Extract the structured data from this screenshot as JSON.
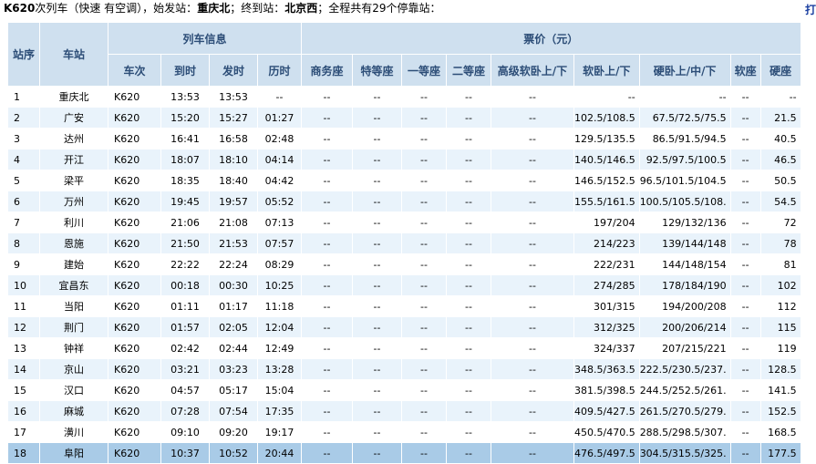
{
  "header": {
    "train_prefix": "K620",
    "train_desc": "次列车（快速 有空调），始发站：",
    "start_station": "重庆北",
    "sep1": "；终到站：",
    "end_station": "北京西",
    "stop_info": "；全程共有29个停靠站：",
    "right_link": "打"
  },
  "table": {
    "group_headers": {
      "seq": "站序",
      "station": "车站",
      "train_info": "列车信息",
      "fare": "票价（元）"
    },
    "columns": [
      "车次",
      "到时",
      "发时",
      "历时",
      "商务座",
      "特等座",
      "一等座",
      "二等座",
      "高级软卧上/下",
      "软卧上/下",
      "硬卧上/中/下",
      "软座",
      "硬座"
    ],
    "rows": [
      {
        "seq": "1",
        "station": "重庆北",
        "train": "K620",
        "arr": "13:53",
        "dep": "13:53",
        "dur": "--",
        "swz": "--",
        "tdz": "--",
        "ydz": "--",
        "edz": "--",
        "gjrw": "--",
        "rw": "--",
        "yw": "--",
        "rz": "--",
        "yz": "--"
      },
      {
        "seq": "2",
        "station": "广安",
        "train": "K620",
        "arr": "15:20",
        "dep": "15:27",
        "dur": "01:27",
        "swz": "--",
        "tdz": "--",
        "ydz": "--",
        "edz": "--",
        "gjrw": "--",
        "rw": "102.5/108.5",
        "yw": "67.5/72.5/75.5",
        "rz": "--",
        "yz": "21.5"
      },
      {
        "seq": "3",
        "station": "达州",
        "train": "K620",
        "arr": "16:41",
        "dep": "16:58",
        "dur": "02:48",
        "swz": "--",
        "tdz": "--",
        "ydz": "--",
        "edz": "--",
        "gjrw": "--",
        "rw": "129.5/135.5",
        "yw": "86.5/91.5/94.5",
        "rz": "--",
        "yz": "40.5"
      },
      {
        "seq": "4",
        "station": "开江",
        "train": "K620",
        "arr": "18:07",
        "dep": "18:10",
        "dur": "04:14",
        "swz": "--",
        "tdz": "--",
        "ydz": "--",
        "edz": "--",
        "gjrw": "--",
        "rw": "140.5/146.5",
        "yw": "92.5/97.5/100.5",
        "rz": "--",
        "yz": "46.5"
      },
      {
        "seq": "5",
        "station": "梁平",
        "train": "K620",
        "arr": "18:35",
        "dep": "18:40",
        "dur": "04:42",
        "swz": "--",
        "tdz": "--",
        "ydz": "--",
        "edz": "--",
        "gjrw": "--",
        "rw": "146.5/152.5",
        "yw": "96.5/101.5/104.5",
        "rz": "--",
        "yz": "50.5"
      },
      {
        "seq": "6",
        "station": "万州",
        "train": "K620",
        "arr": "19:45",
        "dep": "19:57",
        "dur": "05:52",
        "swz": "--",
        "tdz": "--",
        "ydz": "--",
        "edz": "--",
        "gjrw": "--",
        "rw": "155.5/161.5",
        "yw": "100.5/105.5/108.",
        "rz": "--",
        "yz": "54.5"
      },
      {
        "seq": "7",
        "station": "利川",
        "train": "K620",
        "arr": "21:06",
        "dep": "21:08",
        "dur": "07:13",
        "swz": "--",
        "tdz": "--",
        "ydz": "--",
        "edz": "--",
        "gjrw": "--",
        "rw": "197/204",
        "yw": "129/132/136",
        "rz": "--",
        "yz": "72"
      },
      {
        "seq": "8",
        "station": "恩施",
        "train": "K620",
        "arr": "21:50",
        "dep": "21:53",
        "dur": "07:57",
        "swz": "--",
        "tdz": "--",
        "ydz": "--",
        "edz": "--",
        "gjrw": "--",
        "rw": "214/223",
        "yw": "139/144/148",
        "rz": "--",
        "yz": "78"
      },
      {
        "seq": "9",
        "station": "建始",
        "train": "K620",
        "arr": "22:22",
        "dep": "22:24",
        "dur": "08:29",
        "swz": "--",
        "tdz": "--",
        "ydz": "--",
        "edz": "--",
        "gjrw": "--",
        "rw": "222/231",
        "yw": "144/148/154",
        "rz": "--",
        "yz": "81"
      },
      {
        "seq": "10",
        "station": "宜昌东",
        "train": "K620",
        "arr": "00:18",
        "dep": "00:30",
        "dur": "10:25",
        "swz": "--",
        "tdz": "--",
        "ydz": "--",
        "edz": "--",
        "gjrw": "--",
        "rw": "274/285",
        "yw": "178/184/190",
        "rz": "--",
        "yz": "102"
      },
      {
        "seq": "11",
        "station": "当阳",
        "train": "K620",
        "arr": "01:11",
        "dep": "01:17",
        "dur": "11:18",
        "swz": "--",
        "tdz": "--",
        "ydz": "--",
        "edz": "--",
        "gjrw": "--",
        "rw": "301/315",
        "yw": "194/200/208",
        "rz": "--",
        "yz": "112"
      },
      {
        "seq": "12",
        "station": "荆门",
        "train": "K620",
        "arr": "01:57",
        "dep": "02:05",
        "dur": "12:04",
        "swz": "--",
        "tdz": "--",
        "ydz": "--",
        "edz": "--",
        "gjrw": "--",
        "rw": "312/325",
        "yw": "200/206/214",
        "rz": "--",
        "yz": "115"
      },
      {
        "seq": "13",
        "station": "钟祥",
        "train": "K620",
        "arr": "02:42",
        "dep": "02:44",
        "dur": "12:49",
        "swz": "--",
        "tdz": "--",
        "ydz": "--",
        "edz": "--",
        "gjrw": "--",
        "rw": "324/337",
        "yw": "207/215/221",
        "rz": "--",
        "yz": "119"
      },
      {
        "seq": "14",
        "station": "京山",
        "train": "K620",
        "arr": "03:21",
        "dep": "03:23",
        "dur": "13:28",
        "swz": "--",
        "tdz": "--",
        "ydz": "--",
        "edz": "--",
        "gjrw": "--",
        "rw": "348.5/363.5",
        "yw": "222.5/230.5/237.",
        "rz": "--",
        "yz": "128.5"
      },
      {
        "seq": "15",
        "station": "汉口",
        "train": "K620",
        "arr": "04:57",
        "dep": "05:17",
        "dur": "15:04",
        "swz": "--",
        "tdz": "--",
        "ydz": "--",
        "edz": "--",
        "gjrw": "--",
        "rw": "381.5/398.5",
        "yw": "244.5/252.5/261.",
        "rz": "--",
        "yz": "141.5"
      },
      {
        "seq": "16",
        "station": "麻城",
        "train": "K620",
        "arr": "07:28",
        "dep": "07:54",
        "dur": "17:35",
        "swz": "--",
        "tdz": "--",
        "ydz": "--",
        "edz": "--",
        "gjrw": "--",
        "rw": "409.5/427.5",
        "yw": "261.5/270.5/279.",
        "rz": "--",
        "yz": "152.5"
      },
      {
        "seq": "17",
        "station": "潢川",
        "train": "K620",
        "arr": "09:10",
        "dep": "09:20",
        "dur": "19:17",
        "swz": "--",
        "tdz": "--",
        "ydz": "--",
        "edz": "--",
        "gjrw": "--",
        "rw": "450.5/470.5",
        "yw": "288.5/298.5/307.",
        "rz": "--",
        "yz": "168.5"
      },
      {
        "seq": "18",
        "station": "阜阳",
        "train": "K620",
        "arr": "10:37",
        "dep": "10:52",
        "dur": "20:44",
        "swz": "--",
        "tdz": "--",
        "ydz": "--",
        "edz": "--",
        "gjrw": "--",
        "rw": "476.5/497.5",
        "yw": "304.5/315.5/325.",
        "rz": "--",
        "yz": "177.5"
      }
    ]
  }
}
